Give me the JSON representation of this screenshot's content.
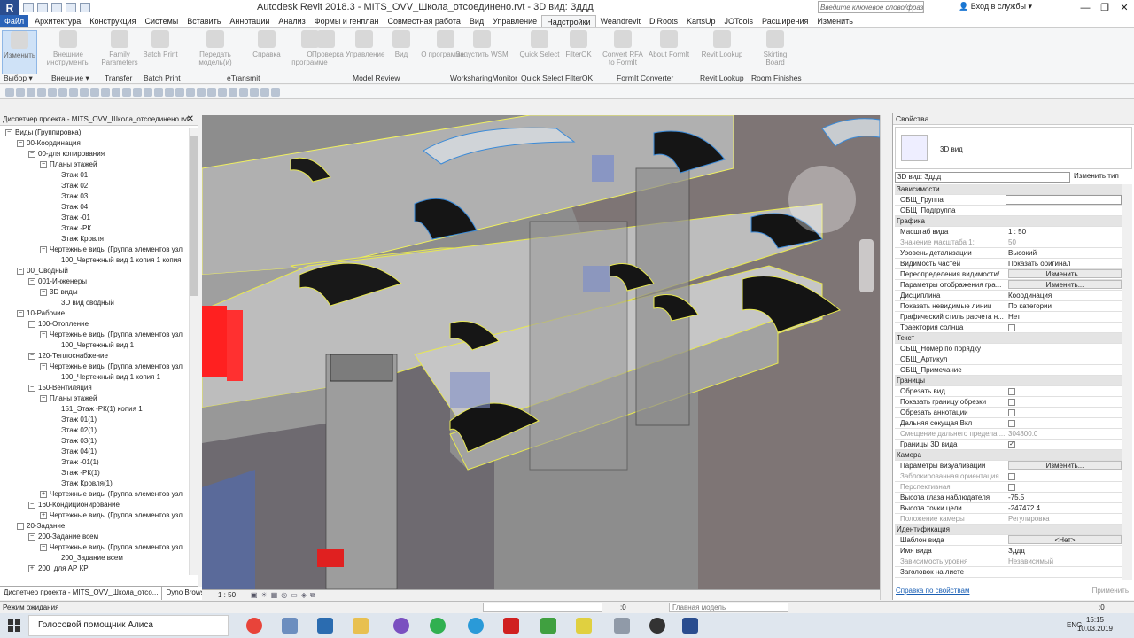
{
  "app": {
    "title": "Autodesk Revit 2018.3 -     MITS_OVV_Школа_отсоединено.rvt - 3D вид: Зддд",
    "logo": "R"
  },
  "search": {
    "placeholder": "Введите ключевое слово/фразу"
  },
  "signin": "Вход в службы",
  "tabs": [
    "Файл",
    "Архитектура",
    "Конструкция",
    "Системы",
    "Вставить",
    "Аннотации",
    "Анализ",
    "Формы и генплан",
    "Совместная работа",
    "Вид",
    "Управление",
    "Надстройки",
    "Weandrevit",
    "DiRoots",
    "KartsUp",
    "JOTools",
    "Расширения",
    "Изменить"
  ],
  "ribbon": {
    "buttons": [
      "Изменить",
      "Внешние инструменты",
      "Family Parameters",
      "Batch Print",
      "Передать модель(и)",
      "Справка",
      "О программе",
      "Проверка",
      "Управление",
      "Вид",
      "О программе...",
      "Запустить WSM",
      "Quick Select",
      "FilterOK",
      "Convert RFA to FormIt",
      "About FormIt",
      "Revit Lookup",
      "Skirting Board"
    ],
    "panels": [
      "Выбор ▾",
      "Внешние ▾",
      "Transfer",
      "Batch Print",
      "eTransmit",
      "Model Review",
      "WorksharingMonitor",
      "Quick Select",
      "FilterOK",
      "FormIt Converter",
      "Revit Lookup",
      "Room Finishes"
    ]
  },
  "project_browser": {
    "title": "Диспетчер проекта - MITS_OVV_Школа_отсоединено.rvt",
    "nodes": [
      {
        "t": "Виды (Группировка)",
        "l": 0,
        "e": "−"
      },
      {
        "t": "00-Координация",
        "l": 1,
        "e": "−"
      },
      {
        "t": "00-для копирования",
        "l": 2,
        "e": "−"
      },
      {
        "t": "Планы этажей",
        "l": 3,
        "e": "−"
      },
      {
        "t": "Этаж 01",
        "l": 4,
        "e": ""
      },
      {
        "t": "Этаж 02",
        "l": 4,
        "e": ""
      },
      {
        "t": "Этаж 03",
        "l": 4,
        "e": ""
      },
      {
        "t": "Этаж 04",
        "l": 4,
        "e": ""
      },
      {
        "t": "Этаж -01",
        "l": 4,
        "e": ""
      },
      {
        "t": "Этаж -РК",
        "l": 4,
        "e": ""
      },
      {
        "t": "Этаж Кровля",
        "l": 4,
        "e": ""
      },
      {
        "t": "Чертежные виды (Группа элементов узл",
        "l": 3,
        "e": "−"
      },
      {
        "t": "100_Чертежный вид 1 копия 1 копия",
        "l": 4,
        "e": ""
      },
      {
        "t": "00_Сводный",
        "l": 1,
        "e": "−"
      },
      {
        "t": "001-Инженеры",
        "l": 2,
        "e": "−"
      },
      {
        "t": "3D виды",
        "l": 3,
        "e": "−"
      },
      {
        "t": "3D вид сводный",
        "l": 4,
        "e": ""
      },
      {
        "t": "10-Рабочие",
        "l": 1,
        "e": "−"
      },
      {
        "t": "100-Отопление",
        "l": 2,
        "e": "−"
      },
      {
        "t": "Чертежные виды (Группа элементов узл",
        "l": 3,
        "e": "−"
      },
      {
        "t": "100_Чертежный вид 1",
        "l": 4,
        "e": ""
      },
      {
        "t": "120-Теплоснабжение",
        "l": 2,
        "e": "−"
      },
      {
        "t": "Чертежные виды (Группа элементов узл",
        "l": 3,
        "e": "−"
      },
      {
        "t": "100_Чертежный вид 1 копия 1",
        "l": 4,
        "e": ""
      },
      {
        "t": "150-Вентиляция",
        "l": 2,
        "e": "−"
      },
      {
        "t": "Планы этажей",
        "l": 3,
        "e": "−"
      },
      {
        "t": "151_Этаж -РК(1) копия 1",
        "l": 4,
        "e": ""
      },
      {
        "t": "Этаж 01(1)",
        "l": 4,
        "e": ""
      },
      {
        "t": "Этаж 02(1)",
        "l": 4,
        "e": ""
      },
      {
        "t": "Этаж 03(1)",
        "l": 4,
        "e": ""
      },
      {
        "t": "Этаж 04(1)",
        "l": 4,
        "e": ""
      },
      {
        "t": "Этаж -01(1)",
        "l": 4,
        "e": ""
      },
      {
        "t": "Этаж -РК(1)",
        "l": 4,
        "e": ""
      },
      {
        "t": "Этаж Кровля(1)",
        "l": 4,
        "e": ""
      },
      {
        "t": "Чертежные виды (Группа элементов узл",
        "l": 3,
        "e": "+"
      },
      {
        "t": "160-Кондиционирование",
        "l": 2,
        "e": "−"
      },
      {
        "t": "Чертежные виды (Группа элементов узл",
        "l": 3,
        "e": "+"
      },
      {
        "t": "20-Задание",
        "l": 1,
        "e": "−"
      },
      {
        "t": "200-Задание всем",
        "l": 2,
        "e": "−"
      },
      {
        "t": "Чертежные виды (Группа элементов узл",
        "l": 3,
        "e": "−"
      },
      {
        "t": "200_Задание всем",
        "l": 4,
        "e": ""
      },
      {
        "t": "200_для АР КР",
        "l": 2,
        "e": "+"
      }
    ],
    "tabs": [
      "Диспетчер проекта - MITS_OVV_Школа_отсо...",
      "Dyno Browser"
    ]
  },
  "view_controls": {
    "scale": "1 : 50"
  },
  "properties": {
    "title": "Свойства",
    "type_name": "3D вид",
    "view_selector": "3D вид: Зддд",
    "edit_type": "Изменить тип",
    "rows": [
      {
        "k": "h",
        "n": "Зависимости"
      },
      {
        "n": "ОБЩ_Группа",
        "v": "",
        "box": true
      },
      {
        "n": "ОБЩ_Подгруппа",
        "v": ""
      },
      {
        "k": "h",
        "n": "Графика"
      },
      {
        "n": "Масштаб вида",
        "v": "1 : 50"
      },
      {
        "n": "Значение масштаба    1:",
        "v": "50",
        "g": true
      },
      {
        "n": "Уровень детализации",
        "v": "Высокий"
      },
      {
        "n": "Видимость частей",
        "v": "Показать оригинал"
      },
      {
        "n": "Переопределения видимости/...",
        "v": "Изменить...",
        "btn": true
      },
      {
        "n": "Параметры отображения гра...",
        "v": "Изменить...",
        "btn": true
      },
      {
        "n": "Дисциплина",
        "v": "Координация"
      },
      {
        "n": "Показать невидимые линии",
        "v": "По категории"
      },
      {
        "n": "Графический стиль расчета н...",
        "v": "Нет"
      },
      {
        "n": "Траектория солнца",
        "c": ""
      },
      {
        "k": "h",
        "n": "Текст"
      },
      {
        "n": "ОБЩ_Номер по порядку",
        "v": ""
      },
      {
        "n": "ОБЩ_Артикул",
        "v": ""
      },
      {
        "n": "ОБЩ_Примечание",
        "v": ""
      },
      {
        "k": "h",
        "n": "Границы"
      },
      {
        "n": "Обрезать вид",
        "c": ""
      },
      {
        "n": "Показать границу обрезки",
        "c": ""
      },
      {
        "n": "Обрезать аннотации",
        "c": ""
      },
      {
        "n": "Дальняя секущая Вкл",
        "c": ""
      },
      {
        "n": "Смещение дальнего предела ...",
        "v": "304800.0",
        "g": true
      },
      {
        "n": "Границы 3D вида",
        "c": "✓"
      },
      {
        "k": "h",
        "n": "Камера"
      },
      {
        "n": "Параметры визуализации",
        "v": "Изменить...",
        "btn": true
      },
      {
        "n": "Заблокированная ориентация",
        "c": "",
        "g": true
      },
      {
        "n": "Перспективная",
        "c": "",
        "g": true
      },
      {
        "n": "Высота глаза наблюдателя",
        "v": "-75.5"
      },
      {
        "n": "Высота точки цели",
        "v": "-247472.4"
      },
      {
        "n": "Положение камеры",
        "v": "Регулировка",
        "g": true
      },
      {
        "k": "h",
        "n": "Идентификация"
      },
      {
        "n": "Шаблон вида",
        "v": "<Нет>",
        "btn": true
      },
      {
        "n": "Имя вида",
        "v": "Зддд"
      },
      {
        "n": "Зависимость уровня",
        "v": "Независимый",
        "g": true
      },
      {
        "n": "Заголовок на листе",
        "v": ""
      }
    ],
    "link": "Справка по свойствам",
    "apply": "Применить"
  },
  "status": {
    "text": "Режим ожидания",
    "counter": ":0",
    "model": "Главная модель",
    "selcount": ":0"
  },
  "taskbar": {
    "assistant": "Голосовой помощник Алиса",
    "lang": "ENG",
    "time": "15:15",
    "date": "10.03.2019"
  },
  "colors": {
    "accent": "#2a63b8",
    "duct": "#a8a8a8",
    "duct_edge": "#e0e050",
    "highlight": "#ff2020"
  }
}
